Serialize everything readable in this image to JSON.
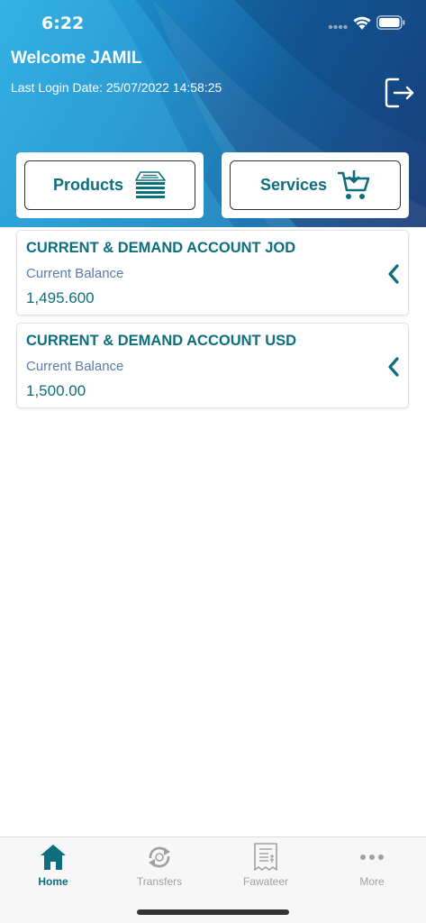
{
  "status_bar": {
    "time": "6:22"
  },
  "header": {
    "welcome": "Welcome JAMIL",
    "last_login": "Last Login Date: 25/07/2022 14:58:25"
  },
  "quick_actions": {
    "products_label": "Products",
    "services_label": "Services"
  },
  "accounts": [
    {
      "name": "CURRENT & DEMAND ACCOUNT JOD",
      "balance_label": "Current Balance",
      "balance": "1,495.600"
    },
    {
      "name": "CURRENT & DEMAND ACCOUNT USD",
      "balance_label": "Current Balance",
      "balance": "1,500.00"
    }
  ],
  "tabs": [
    {
      "label": "Home",
      "icon": "home-icon",
      "active": true
    },
    {
      "label": "Transfers",
      "icon": "transfers-icon",
      "active": false
    },
    {
      "label": "Fawateer",
      "icon": "bill-icon",
      "active": false
    },
    {
      "label": "More",
      "icon": "more-icon",
      "active": false
    }
  ],
  "colors": {
    "accent": "#0d6e7e",
    "header_gradient_start": "#2aa6dd",
    "header_gradient_end": "#1d3f7a",
    "balance_label": "#5a7aa8",
    "tab_inactive": "#a0a0a0"
  }
}
